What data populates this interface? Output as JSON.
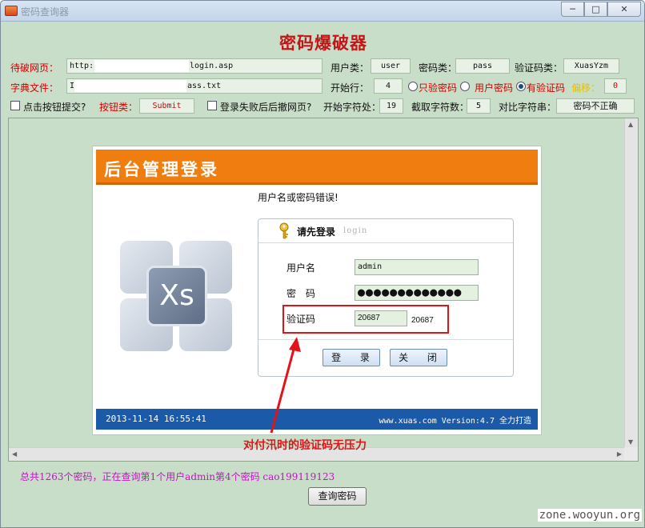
{
  "window": {
    "title": "密码查询器",
    "controls": [
      "─",
      "□",
      "✕"
    ]
  },
  "app": {
    "heading": "密码爆破器"
  },
  "form": {
    "target_label": "待破网页：",
    "target_url_prefix": "http:",
    "target_url_suffix": "login.asp",
    "user_field_label": "用户类：",
    "user_field_value": "user",
    "pass_field_label": "密码类：",
    "pass_field_value": "pass",
    "captcha_field_label": "验证码类：",
    "captcha_field_value": "XuasYzm",
    "dict_label": "字典文件：",
    "dict_prefix": "I",
    "dict_suffix": "ass.txt",
    "start_line_label": "开始行：",
    "start_line_value": "4",
    "mode_only_captcha": "只验密码",
    "mode_user_pass": "用户密码",
    "mode_with_captcha": "有验证码",
    "offset_label": "偏移：",
    "offset_value": "0",
    "click_submit_label": "点击按钮提交?",
    "button_type_label": "按钮类：",
    "button_type_value": "Submit",
    "retry_label": "登录失败后后撤网页?",
    "start_char_label": "开始字符处：",
    "start_char_value": "19",
    "cut_len_label": "截取字符数：",
    "cut_len_value": "5",
    "compare_label": "对比字符串：",
    "compare_value": "密码不正确"
  },
  "login_page": {
    "header_title": "后台管理登录",
    "error_message": "用户名或密码错误!",
    "box_title": "请先登录",
    "box_subtitle": "login",
    "username_label": "用户名",
    "username_value": "admin",
    "password_label": "密　码",
    "password_value": "●●●●●●●●●●●●●",
    "captcha_label": "验证码",
    "captcha_input": "20687",
    "captcha_image_text": "20687",
    "login_button": "登 录",
    "close_button": "关 闭",
    "logo_text": "Xs",
    "footer_date": "2013-11-14 16:55:41",
    "footer_version": "www.xuas.com Version:4.7 全力打造"
  },
  "annotation": "对付汛时的验证码无压力",
  "status": "总共1263个密码，正在查询第1个用户admin第4个密码 cao199119123",
  "query_button": "查询密码",
  "watermark": "zone.wooyun.org",
  "colors": {
    "accent_red": "#d40000",
    "status_magenta": "#c016c0",
    "header_orange": "#f07d10",
    "footer_blue": "#1b5aa8",
    "window_bg": "#c9dec9"
  }
}
